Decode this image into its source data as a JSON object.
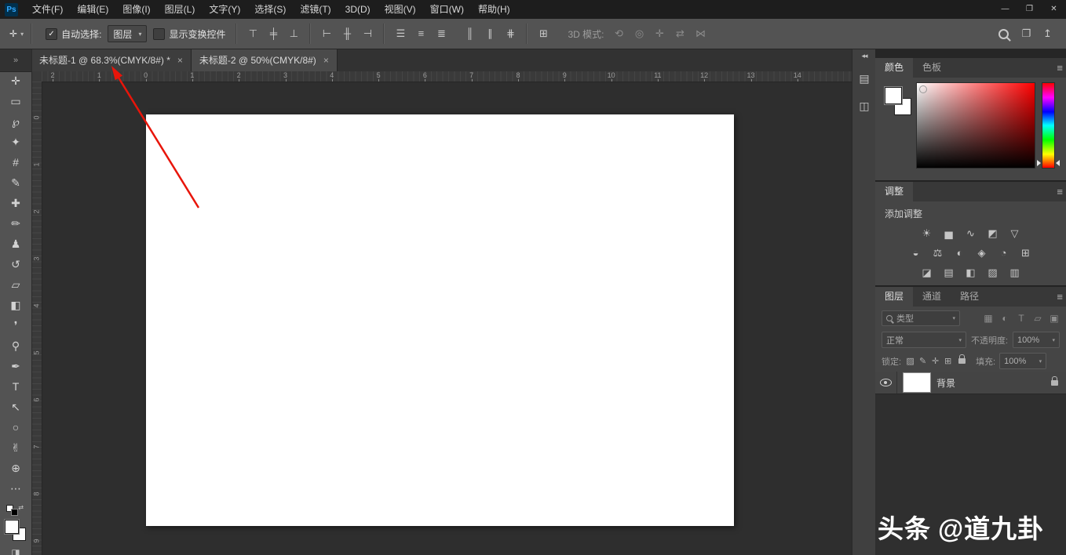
{
  "colors": {
    "annotation_arrow": "#e8150a",
    "foreground_swatch": "#ffffff",
    "background_swatch": "#ffffff"
  },
  "glyphs": {
    "chevron_down": "▾",
    "panel_menu": "≡",
    "tab_close": "×",
    "check": "✓"
  },
  "menu": {
    "app_icon_text": "Ps",
    "items": [
      "文件(F)",
      "编辑(E)",
      "图像(I)",
      "图层(L)",
      "文字(Y)",
      "选择(S)",
      "滤镜(T)",
      "3D(D)",
      "视图(V)",
      "窗口(W)",
      "帮助(H)"
    ],
    "window_controls": [
      {
        "name": "minimize-button",
        "glyph": "—"
      },
      {
        "name": "restore-button",
        "glyph": "❐"
      },
      {
        "name": "close-button",
        "glyph": "✕"
      }
    ]
  },
  "options_bar": {
    "move_tool_glyph": "✛",
    "auto_select_label": "自动选择:",
    "auto_select_target": "图层",
    "show_transform_label": "显示变换控件",
    "align_a": [
      {
        "name": "align-top-edges-icon",
        "glyph": "⊤"
      },
      {
        "name": "align-vertical-centers-icon",
        "glyph": "╪"
      },
      {
        "name": "align-bottom-edges-icon",
        "glyph": "⊥"
      }
    ],
    "align_b": [
      {
        "name": "align-left-edges-icon",
        "glyph": "⊢"
      },
      {
        "name": "align-horizontal-centers-icon",
        "glyph": "╫"
      },
      {
        "name": "align-right-edges-icon",
        "glyph": "⊣"
      }
    ],
    "distribute_a": [
      {
        "name": "distribute-top-edges-icon",
        "glyph": "☰"
      },
      {
        "name": "distribute-vertical-centers-icon",
        "glyph": "≡"
      },
      {
        "name": "distribute-bottom-edges-icon",
        "glyph": "≣"
      }
    ],
    "distribute_b": [
      {
        "name": "distribute-left-edges-icon",
        "glyph": "║"
      },
      {
        "name": "distribute-horizontal-centers-icon",
        "glyph": "∥"
      },
      {
        "name": "distribute-right-edges-icon",
        "glyph": "⋕"
      }
    ],
    "extra_icon": {
      "name": "align-and-distribute-icon",
      "glyph": "⊞"
    },
    "threed_label": "3D 模式:",
    "threed_icons": [
      {
        "name": "3d-rotate-icon",
        "glyph": "⟲"
      },
      {
        "name": "3d-roll-icon",
        "glyph": "◎"
      },
      {
        "name": "3d-drag-icon",
        "glyph": "✛"
      },
      {
        "name": "3d-slide-icon",
        "glyph": "⇄"
      },
      {
        "name": "3d-scale-icon",
        "glyph": "⋈"
      }
    ],
    "right_icons": [
      {
        "name": "workspace-switcher-icon",
        "glyph": "❐"
      },
      {
        "name": "share-icon",
        "glyph": "↥"
      }
    ]
  },
  "document_tabs": [
    {
      "title": "未标题-1 @ 68.3%(CMYK/8#) *"
    },
    {
      "title": "未标题-2 @ 50%(CMYK/8#)"
    }
  ],
  "toolbar": {
    "collapse_glyph": "»",
    "tools": [
      {
        "name": "move-tool",
        "glyph": "✛"
      },
      {
        "name": "rectangular-marquee-tool",
        "glyph": "▭"
      },
      {
        "name": "lasso-tool",
        "glyph": "℘"
      },
      {
        "name": "quick-selection-tool",
        "glyph": "✦"
      },
      {
        "name": "crop-tool",
        "glyph": "#"
      },
      {
        "name": "eyedropper-tool",
        "glyph": "✎"
      },
      {
        "name": "spot-healing-brush-tool",
        "glyph": "✚"
      },
      {
        "name": "brush-tool",
        "glyph": "✏"
      },
      {
        "name": "clone-stamp-tool",
        "glyph": "♟"
      },
      {
        "name": "history-brush-tool",
        "glyph": "↺"
      },
      {
        "name": "eraser-tool",
        "glyph": "▱"
      },
      {
        "name": "gradient-tool",
        "glyph": "◧"
      },
      {
        "name": "blur-tool",
        "glyph": "❜"
      },
      {
        "name": "dodge-tool",
        "glyph": "⚲"
      },
      {
        "name": "pen-tool",
        "glyph": "✒"
      },
      {
        "name": "type-tool",
        "glyph": "T"
      },
      {
        "name": "path-selection-tool",
        "glyph": "↖"
      },
      {
        "name": "ellipse-tool",
        "glyph": "○"
      },
      {
        "name": "hand-tool",
        "glyph": "✌"
      },
      {
        "name": "zoom-tool",
        "glyph": "⊕"
      },
      {
        "name": "edit-toolbar-icon",
        "glyph": "⋯"
      }
    ]
  },
  "rulers": {
    "h_labels": [
      "2",
      "1",
      "0",
      "1",
      "2",
      "3",
      "4",
      "5",
      "6",
      "7",
      "8",
      "9",
      "10",
      "11",
      "12",
      "13",
      "14"
    ],
    "h_start": 14,
    "h_spacing": 59.3,
    "v_labels": [
      "0",
      "1",
      "2",
      "3",
      "4",
      "5",
      "6",
      "7",
      "8",
      "9"
    ],
    "v_start": 48,
    "v_spacing": 60
  },
  "panels": {
    "dock_strip": {
      "collapse_glyph": "◂◂",
      "icons": [
        {
          "name": "properties-panel-icon",
          "glyph": "▤"
        },
        {
          "name": "libraries-panel-icon",
          "glyph": "◫"
        }
      ]
    },
    "color": {
      "tabs": [
        "颜色",
        "色板"
      ]
    },
    "adjustments": {
      "tab": "调整",
      "add_label": "添加调整",
      "row1": [
        {
          "name": "brightness-contrast-icon",
          "glyph": "☀"
        },
        {
          "name": "levels-icon",
          "glyph": "▅"
        },
        {
          "name": "curves-icon",
          "glyph": "∿"
        },
        {
          "name": "exposure-icon",
          "glyph": "◩"
        },
        {
          "name": "vibrance-icon",
          "glyph": "▽"
        }
      ],
      "row2": [
        {
          "name": "hue-saturation-icon",
          "glyph": "◒"
        },
        {
          "name": "color-balance-icon",
          "glyph": "⚖"
        },
        {
          "name": "black-white-icon",
          "glyph": "◐"
        },
        {
          "name": "photo-filter-icon",
          "glyph": "◈"
        },
        {
          "name": "channel-mixer-icon",
          "glyph": "◔"
        },
        {
          "name": "color-lookup-icon",
          "glyph": "⊞"
        }
      ],
      "row3": [
        {
          "name": "invert-icon",
          "glyph": "◪"
        },
        {
          "name": "posterize-icon",
          "glyph": "▤"
        },
        {
          "name": "threshold-icon",
          "glyph": "◧"
        },
        {
          "name": "gradient-map-icon",
          "glyph": "▨"
        },
        {
          "name": "selective-color-icon",
          "glyph": "▥"
        }
      ]
    },
    "layers": {
      "tabs": [
        "图层",
        "通道",
        "路径"
      ],
      "filter_label": "类型",
      "filter_icons": [
        {
          "name": "filter-pixel-layers-icon",
          "glyph": "▦"
        },
        {
          "name": "filter-adjustment-layers-icon",
          "glyph": "◐"
        },
        {
          "name": "filter-type-layers-icon",
          "glyph": "T"
        },
        {
          "name": "filter-shape-layers-icon",
          "glyph": "▱"
        },
        {
          "name": "filter-smart-objects-icon",
          "glyph": "▣"
        }
      ],
      "blend_mode": "正常",
      "opacity_label": "不透明度:",
      "opacity_value": "100%",
      "lock_label": "锁定:",
      "lock_icons": [
        {
          "name": "lock-transparent-pixels-icon",
          "glyph": "▨"
        },
        {
          "name": "lock-image-pixels-icon",
          "glyph": "✎"
        },
        {
          "name": "lock-position-icon",
          "glyph": "✛"
        },
        {
          "name": "lock-artboard-icon",
          "glyph": "⊞"
        }
      ],
      "fill_label": "填充:",
      "fill_value": "100%",
      "layer": {
        "name": "背景"
      }
    }
  },
  "watermark": {
    "brand": "头条",
    "handle": "@道九卦"
  }
}
